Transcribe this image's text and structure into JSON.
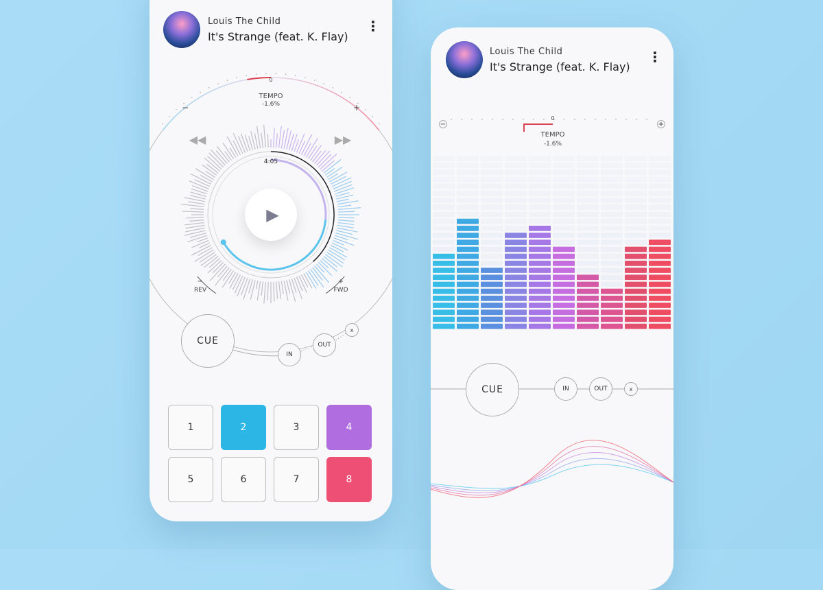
{
  "track": {
    "artist": "Louis The Child",
    "title": "It's Strange (feat. K. Flay)"
  },
  "tempo": {
    "label": "TEMPO",
    "value": "-1.6%",
    "zero": "0",
    "minus": "−",
    "plus": "+",
    "percent": -1.6
  },
  "deck": {
    "time": "4:05",
    "rev_label": "REV",
    "fwd_label": "FWD",
    "rev_sign": "−",
    "fwd_sign": "+",
    "progress": 0.62
  },
  "cue": {
    "cue_label": "CUE",
    "in_label": "IN",
    "out_label": "OUT",
    "close_label": "x"
  },
  "pads": [
    {
      "label": "1",
      "active": false
    },
    {
      "label": "2",
      "active": true,
      "color": "#2bb6e6"
    },
    {
      "label": "3",
      "active": false
    },
    {
      "label": "4",
      "active": true,
      "color": "#b06de0"
    },
    {
      "label": "5",
      "active": false
    },
    {
      "label": "6",
      "active": false
    },
    {
      "label": "7",
      "active": false
    },
    {
      "label": "8",
      "active": true,
      "color": "#ee4f74"
    }
  ],
  "equalizer": {
    "rows": 25,
    "levels": [
      11,
      16,
      9,
      14,
      15,
      12,
      8,
      6,
      12,
      13
    ],
    "colors": [
      "#38bde6",
      "#3fa9e3",
      "#5b8fe0",
      "#8a84e2",
      "#a678e6",
      "#c66ee0",
      "#d45aa8",
      "#dd5590",
      "#e2506e",
      "#ee4d62"
    ]
  },
  "colors": {
    "accent_blue": "#4cc3ec",
    "accent_purple": "#b89cec",
    "accent_red": "#e04a5c"
  }
}
